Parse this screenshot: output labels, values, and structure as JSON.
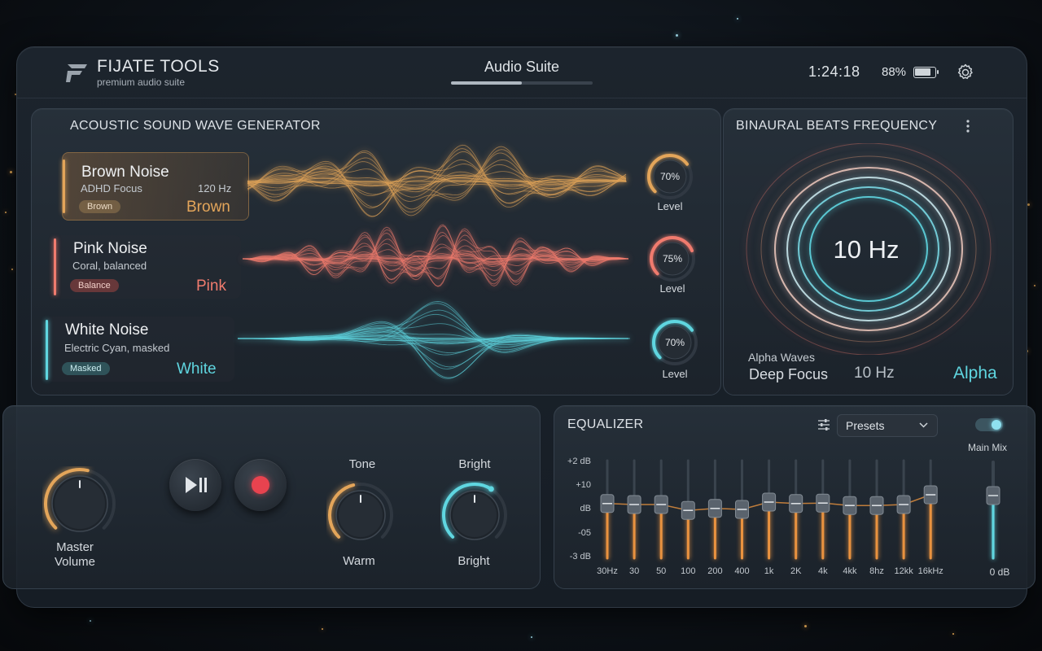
{
  "app": {
    "brand_name": "FIJATE TOOLS",
    "brand_sub": "premium audio suite",
    "title": "Audio Suite",
    "title_progress": 0.5,
    "clock": "1:24:18",
    "battery_pct": "88%",
    "battery_level": 0.88
  },
  "generator": {
    "title": "Acoustic Sound Wave Generator",
    "tracks": [
      {
        "name": "Brown Noise",
        "sub": "ADHD Focus",
        "freq": "120 Hz",
        "badge": "Brown",
        "label": "Brown",
        "color": "#e3a55a",
        "level": "70%",
        "level_value": 0.7,
        "level_label": "Level"
      },
      {
        "name": "Pink Noise",
        "sub": "Coral, balanced",
        "freq": "",
        "badge": "Balance",
        "label": "Pink",
        "color": "#f07b6e",
        "level": "75%",
        "level_value": 0.75,
        "level_label": "Level"
      },
      {
        "name": "White Noise",
        "sub": "Electric Cyan, masked",
        "freq": "",
        "badge": "Masked",
        "label": "White",
        "color": "#5fd6e0",
        "level": "70%",
        "level_value": 0.7,
        "level_label": "Level"
      }
    ]
  },
  "binaural": {
    "title": "Binaural Beats Frequency",
    "frequency": "10 Hz",
    "wave_type": "Alpha Waves",
    "mode": "Deep Focus",
    "mode_freq": "10 Hz",
    "band": "Alpha"
  },
  "transport": {
    "master_label_1": "Master",
    "master_label_2": "Volume",
    "tone_top": "Tone",
    "tone_bottom": "Warm",
    "bright_top": "Bright",
    "bright_bottom": "Bright"
  },
  "equalizer": {
    "title": "Equalizer",
    "presets_label": "Presets",
    "main_mix_label": "Main Mix",
    "main_mix_value": "0 dB",
    "y_labels": [
      "+2 dB",
      "+10",
      "dB",
      "-05",
      "-3 dB"
    ],
    "bands": [
      "30Hz",
      "30",
      "50",
      "100",
      "200",
      "400",
      "1k",
      "2K",
      "4k",
      "4kk",
      "8hz",
      "12kk",
      "16kHz"
    ],
    "band_levels": [
      0.02,
      0.0,
      0.0,
      -0.12,
      -0.08,
      -0.1,
      0.05,
      0.02,
      0.03,
      -0.02,
      -0.02,
      0.0,
      0.2
    ]
  },
  "colors": {
    "brown": "#e3a55a",
    "pink": "#f07b6e",
    "white": "#5fd6e0",
    "record": "#e8434f"
  }
}
